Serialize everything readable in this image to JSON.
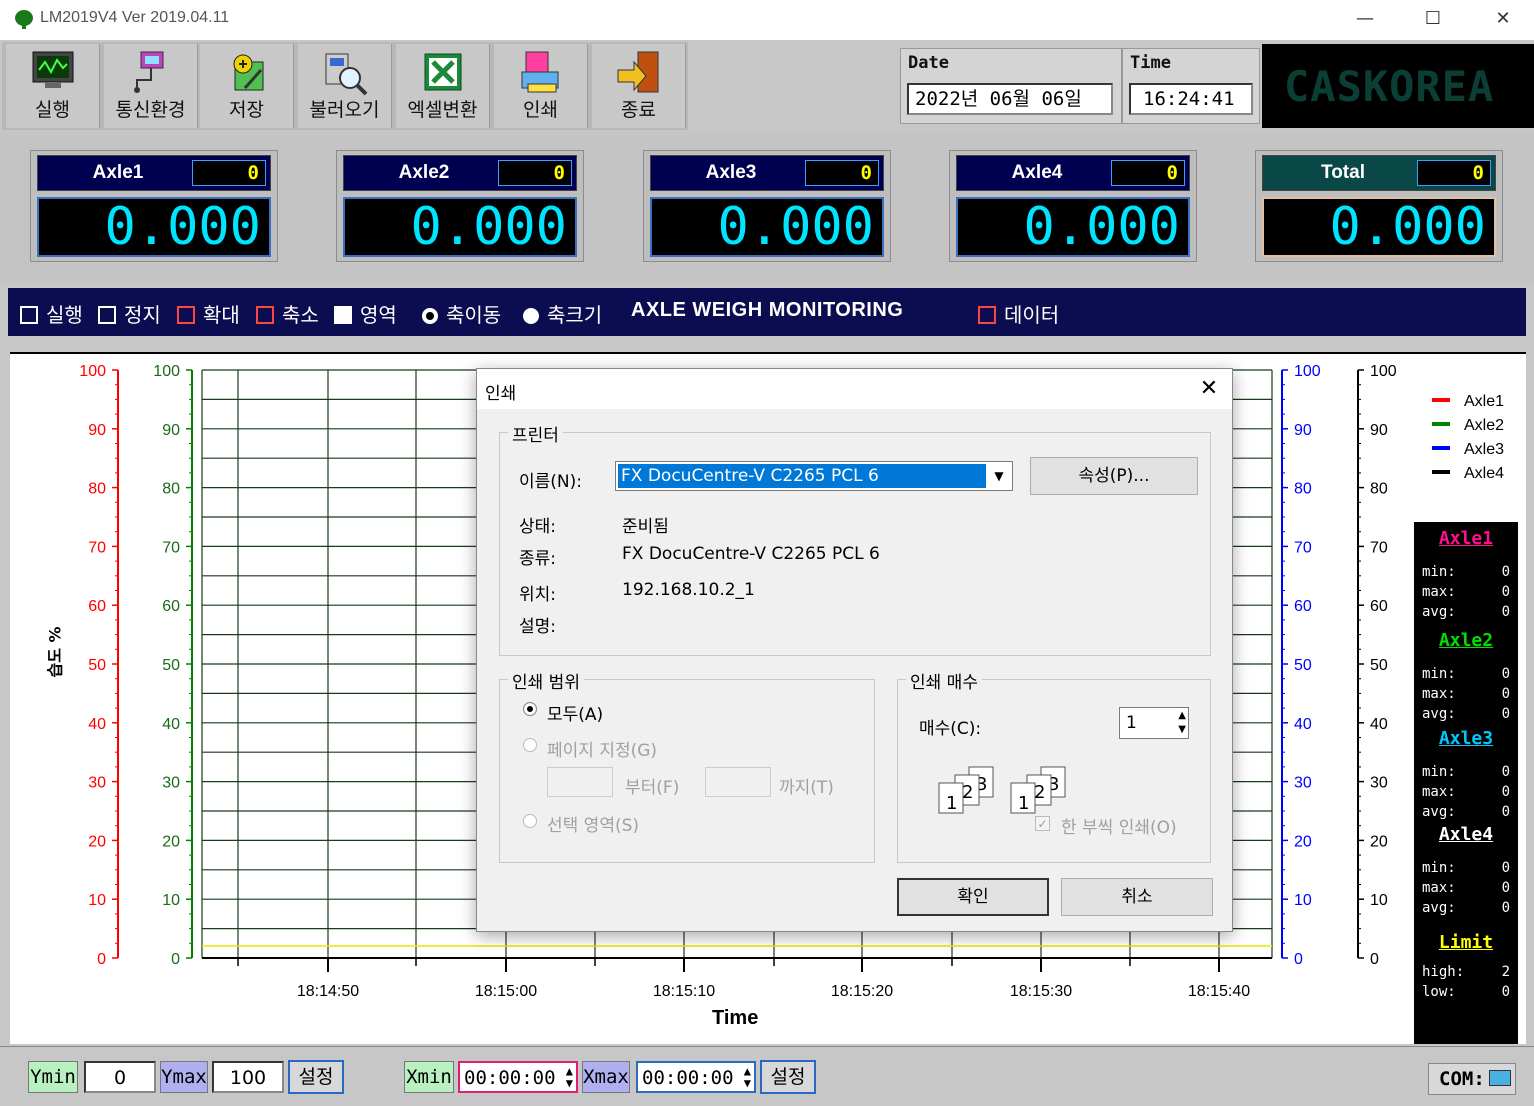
{
  "window": {
    "title": "LM2019V4   Ver 2019.04.11"
  },
  "toolbar": [
    {
      "label": "실행",
      "icon": "monitor-icon"
    },
    {
      "label": "통신환경",
      "icon": "network-icon"
    },
    {
      "label": "저장",
      "icon": "save-icon"
    },
    {
      "label": "불러오기",
      "icon": "open-icon"
    },
    {
      "label": "엑셀변환",
      "icon": "excel-icon"
    },
    {
      "label": "인쇄",
      "icon": "printer-icon"
    },
    {
      "label": "종료",
      "icon": "exit-icon"
    }
  ],
  "datetime": {
    "date_label": "Date",
    "date_value": "2022년  06월  06일",
    "time_label": "Time",
    "time_value": "16:24:41"
  },
  "brand": "CASKOREA",
  "axles": [
    {
      "name": "Axle1",
      "count": "0",
      "value": "0.000"
    },
    {
      "name": "Axle2",
      "count": "0",
      "value": "0.000"
    },
    {
      "name": "Axle3",
      "count": "0",
      "value": "0.000"
    },
    {
      "name": "Axle4",
      "count": "0",
      "value": "0.000"
    },
    {
      "name": "Total",
      "count": "0",
      "value": "0.000"
    }
  ],
  "chart_toolbar": {
    "run": "실행",
    "stop": "정지",
    "zoom_in": "확대",
    "zoom_out": "축소",
    "region": "영역",
    "axis_move": "축이동",
    "axis_size": "축크기",
    "title": "AXLE WEIGH MONITORING",
    "data": "데이터"
  },
  "chart_data": {
    "type": "line",
    "x_ticks": [
      "18:14:50",
      "18:15:00",
      "18:15:10",
      "18:15:20",
      "18:15:30",
      "18:15:40"
    ],
    "xlabel": "Time",
    "ylabel": "습도 %",
    "ylim": [
      0,
      100
    ],
    "y_ticks": [
      0,
      10,
      20,
      30,
      40,
      50,
      60,
      70,
      80,
      90,
      100
    ],
    "series": [
      {
        "name": "Axle1",
        "color": "#ff0000",
        "values": []
      },
      {
        "name": "Axle2",
        "color": "#008000",
        "values": []
      },
      {
        "name": "Axle3",
        "color": "#0000ff",
        "values": []
      },
      {
        "name": "Axle4",
        "color": "#000000",
        "values": []
      }
    ],
    "grid": true,
    "legend": "top-right",
    "axis_colors": [
      "#ff0000",
      "#008000",
      "#0000ff",
      "#000000"
    ]
  },
  "stats": [
    {
      "name": "Axle1",
      "color": "#ff1090",
      "min": "0",
      "max": "0",
      "avg": "0"
    },
    {
      "name": "Axle2",
      "color": "#00e000",
      "min": "0",
      "max": "0",
      "avg": "0"
    },
    {
      "name": "Axle3",
      "color": "#00c8ff",
      "min": "0",
      "max": "0",
      "avg": "0"
    },
    {
      "name": "Axle4",
      "color": "#ffffff",
      "min": "0",
      "max": "0",
      "avg": "0"
    }
  ],
  "stat_labels": {
    "min": "min:",
    "max": "max:",
    "avg": "avg:"
  },
  "limit": {
    "title": "Limit",
    "high_label": "high:",
    "high": "2",
    "low_label": "low:",
    "low": "0"
  },
  "bottom": {
    "ymin_label": "Ymin",
    "ymin": "0",
    "ymax_label": "Ymax",
    "ymax": "100",
    "set1": "설정",
    "xmin_label": "Xmin",
    "xmin": "00:00:00",
    "xmax_label": "Xmax",
    "xmax": "00:00:00",
    "set2": "설정",
    "com_label": "COM:"
  },
  "dialog": {
    "title": "인쇄",
    "printer_group": "프린터",
    "name_label": "이름(N):",
    "name_value": "FX DocuCentre-V C2265 PCL 6",
    "properties": "속성(P)...",
    "status_label": "상태:",
    "status_value": "준비됨",
    "type_label": "종류:",
    "type_value": "FX DocuCentre-V C2265 PCL 6",
    "where_label": "위치:",
    "where_value": "192.168.10.2_1",
    "comment_label": "설명:",
    "range_group": "인쇄 범위",
    "all": "모두(A)",
    "pages": "페이지 지정(G)",
    "from": "부터(F)",
    "to": "까지(T)",
    "selection": "선택 영역(S)",
    "copies_group": "인쇄 매수",
    "copies_label": "매수(C):",
    "copies_value": "1",
    "collate": "한 부씩 인쇄(O)",
    "ok": "확인",
    "cancel": "취소"
  }
}
